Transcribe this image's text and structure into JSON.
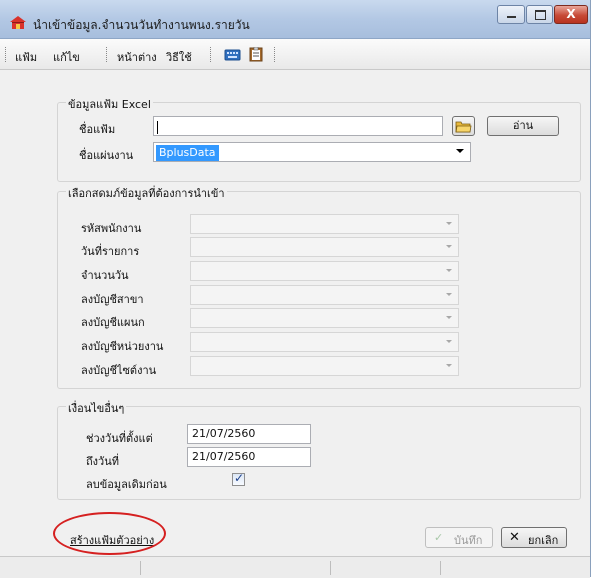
{
  "window": {
    "title": "นำเข้าข้อมูล.จำนวนวันทำงานพนง.รายวัน",
    "close_glyph": "X",
    "colors": {
      "titlebar": "#b3c8e4",
      "close": "#c74a37",
      "annotation": "#d52020"
    }
  },
  "toolbar": {
    "menu": [
      "แฟ้ม",
      "แก้ไข",
      "หน้าต่าง",
      "วิธีใช้"
    ],
    "icons": [
      "keyboard-icon",
      "clipboard-icon"
    ]
  },
  "excel_group": {
    "legend": "ข้อมูลแฟ้ม Excel",
    "file_label": "ชื่อแฟ้ม",
    "file_value": "",
    "folder_icon": "open-folder-icon",
    "read_button": "อ่าน",
    "sheet_label": "ชื่อแผ่นงาน",
    "sheet_value": "BplusData"
  },
  "fields_group": {
    "legend": "เลือกสดมภ์ข้อมูลที่ต้องการนำเข้า",
    "fields": [
      {
        "label": "รหัสพนักงาน",
        "value": ""
      },
      {
        "label": "วันที่รายการ",
        "value": ""
      },
      {
        "label": "จำนวนวัน",
        "value": ""
      },
      {
        "label": "ลงบัญชีสาขา",
        "value": ""
      },
      {
        "label": "ลงบัญชีแผนก",
        "value": ""
      },
      {
        "label": "ลงบัญชีหน่วยงาน",
        "value": ""
      },
      {
        "label": "ลงบัญชีไซต์งาน",
        "value": ""
      }
    ]
  },
  "conditions_group": {
    "legend": "เงื่อนไขอื่นๆ",
    "from_label": "ช่วงวันที่ตั้งแต่",
    "from_value": "21/07/2560",
    "to_label": "ถึงวันที่",
    "to_value": "21/07/2560",
    "delete_label": "ลบข้อมูลเดิมก่อน",
    "delete_checked": true,
    "check_glyph": "✓"
  },
  "footer": {
    "sample_link": "สร้างแฟ้มตัวอย่าง",
    "save_button": "บันทึก",
    "save_glyph": "✓",
    "cancel_button": "ยกเลิก",
    "cancel_glyph": "✕"
  }
}
